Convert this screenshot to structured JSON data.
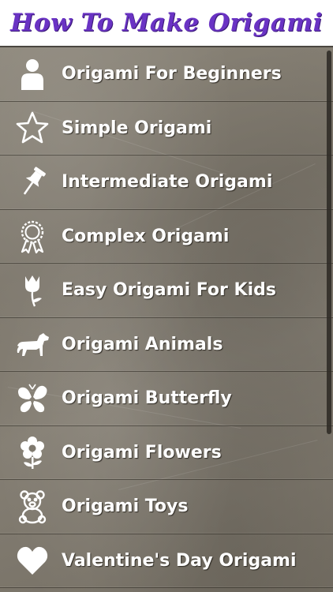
{
  "app": {
    "title": "How To Make Origami",
    "title_color": "#6a33c4"
  },
  "menu": {
    "items": [
      {
        "label": "Origami For Beginners",
        "icon": "person-icon"
      },
      {
        "label": "Simple Origami",
        "icon": "star-icon"
      },
      {
        "label": "Intermediate Origami",
        "icon": "pushpin-icon"
      },
      {
        "label": "Complex Origami",
        "icon": "award-ribbon-icon"
      },
      {
        "label": "Easy Origami For Kids",
        "icon": "tulip-icon"
      },
      {
        "label": "Origami Animals",
        "icon": "dog-icon"
      },
      {
        "label": "Origami Butterfly",
        "icon": "butterfly-icon"
      },
      {
        "label": "Origami Flowers",
        "icon": "flower-icon"
      },
      {
        "label": "Origami Toys",
        "icon": "teddy-bear-icon"
      },
      {
        "label": "Valentine's Day Origami",
        "icon": "heart-icon"
      }
    ]
  },
  "colors": {
    "background": "#7f796e",
    "text": "#ffffff",
    "separator": "#3a362f"
  }
}
